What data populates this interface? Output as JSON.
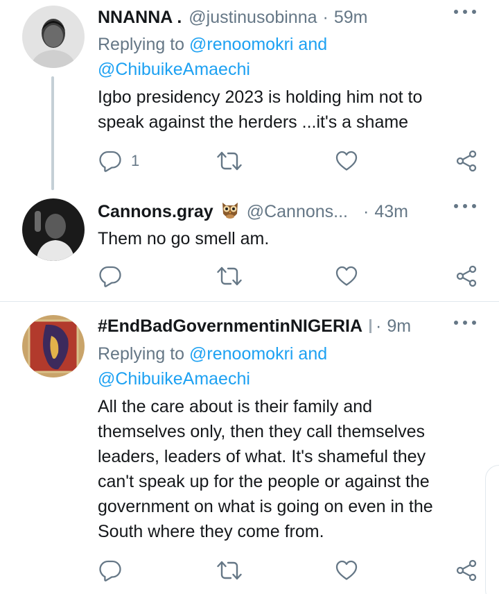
{
  "tweets": [
    {
      "name": "NNANNA .",
      "handle": "@justinusobinna",
      "time": "59m",
      "replying_prefix": "Replying to ",
      "replying_user1": "@renoomokri",
      "replying_and": " and",
      "replying_user2": "@ChibuikeAmaechi",
      "text_lines": [
        "Igbo presidency 2023 is holding him not to",
        "speak against the herders  ...it's a shame"
      ],
      "reply_count": "1"
    },
    {
      "name": "Cannons.gray",
      "handle": "@Cannons...",
      "time": "43m",
      "text_lines": [
        "Them no go smell am."
      ]
    },
    {
      "name": "#EndBadGovernmentinNIGERIA",
      "time": "9m",
      "replying_prefix": "Replying to ",
      "replying_user1": "@renoomokri",
      "replying_and": " and",
      "replying_user2": "@ChibuikeAmaechi",
      "text_lines": [
        "All the care about is their family and",
        "themselves only, then they call themselves",
        "leaders, leaders of what. It's shameful they",
        "can't speak up for the people or against the",
        "government on what is going on even in the",
        "South where they come from."
      ]
    }
  ],
  "colors": {
    "link": "#1da1f2",
    "muted": "#657786",
    "text": "#14171a",
    "line": "#c4cfd6"
  },
  "icons": [
    "reply-icon",
    "retweet-icon",
    "like-icon",
    "share-icon",
    "more-icon",
    "owl-emoji-icon"
  ]
}
